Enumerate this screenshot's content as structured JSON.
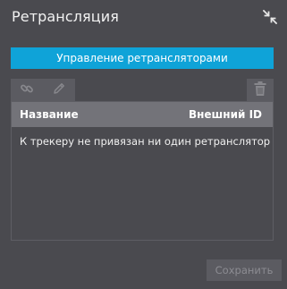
{
  "window": {
    "title": "Ретрансляция",
    "collapse_icon": "collapse-arrows-icon"
  },
  "actions": {
    "manage_label": "Управление ретрансляторами",
    "save_label": "Сохранить"
  },
  "toolbar": {
    "icons": [
      "link-icon",
      "pencil-icon",
      "trash-icon"
    ]
  },
  "table": {
    "columns": [
      "Название",
      "Внешний ID"
    ],
    "empty_message": "К трекеру не привязан ни один ретранслятор"
  },
  "colors": {
    "background": "#4a4a4f",
    "accent": "#0fa3d8",
    "header": "#737379",
    "toolbar_button": "#5b5b61"
  }
}
